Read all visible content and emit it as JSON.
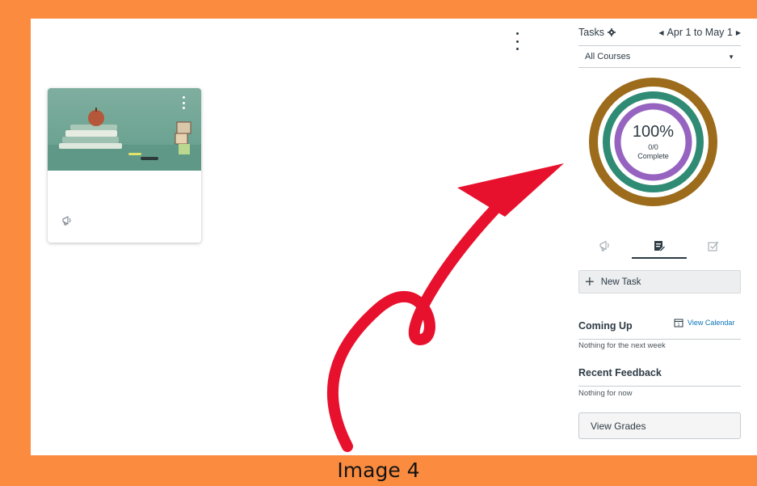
{
  "tasks": {
    "title": "Tasks",
    "range": "Apr 1 to May 1",
    "courses_filter": "All Courses"
  },
  "progress": {
    "percent_label": "100%",
    "fraction": "0/0",
    "status": "Complete",
    "ring_colors": [
      "#9c6b1b",
      "#2f8b73",
      "#9664c0"
    ]
  },
  "icon_tabs": [
    {
      "icon": "megaphone-icon"
    },
    {
      "icon": "edit-document-icon",
      "selected": true
    },
    {
      "icon": "checkbox-icon"
    }
  ],
  "new_task_label": "New Task",
  "coming_up": {
    "title": "Coming Up",
    "view_calendar": "View Calendar",
    "calendar_day": "1",
    "empty": "Nothing for the next week"
  },
  "recent_feedback": {
    "title": "Recent Feedback",
    "empty": "Nothing for now"
  },
  "view_grades": "View Grades",
  "caption": "Image 4",
  "colors": {
    "frame": "#fb8c3f",
    "arrow": "#e8112d",
    "link": "#0b74b8"
  }
}
